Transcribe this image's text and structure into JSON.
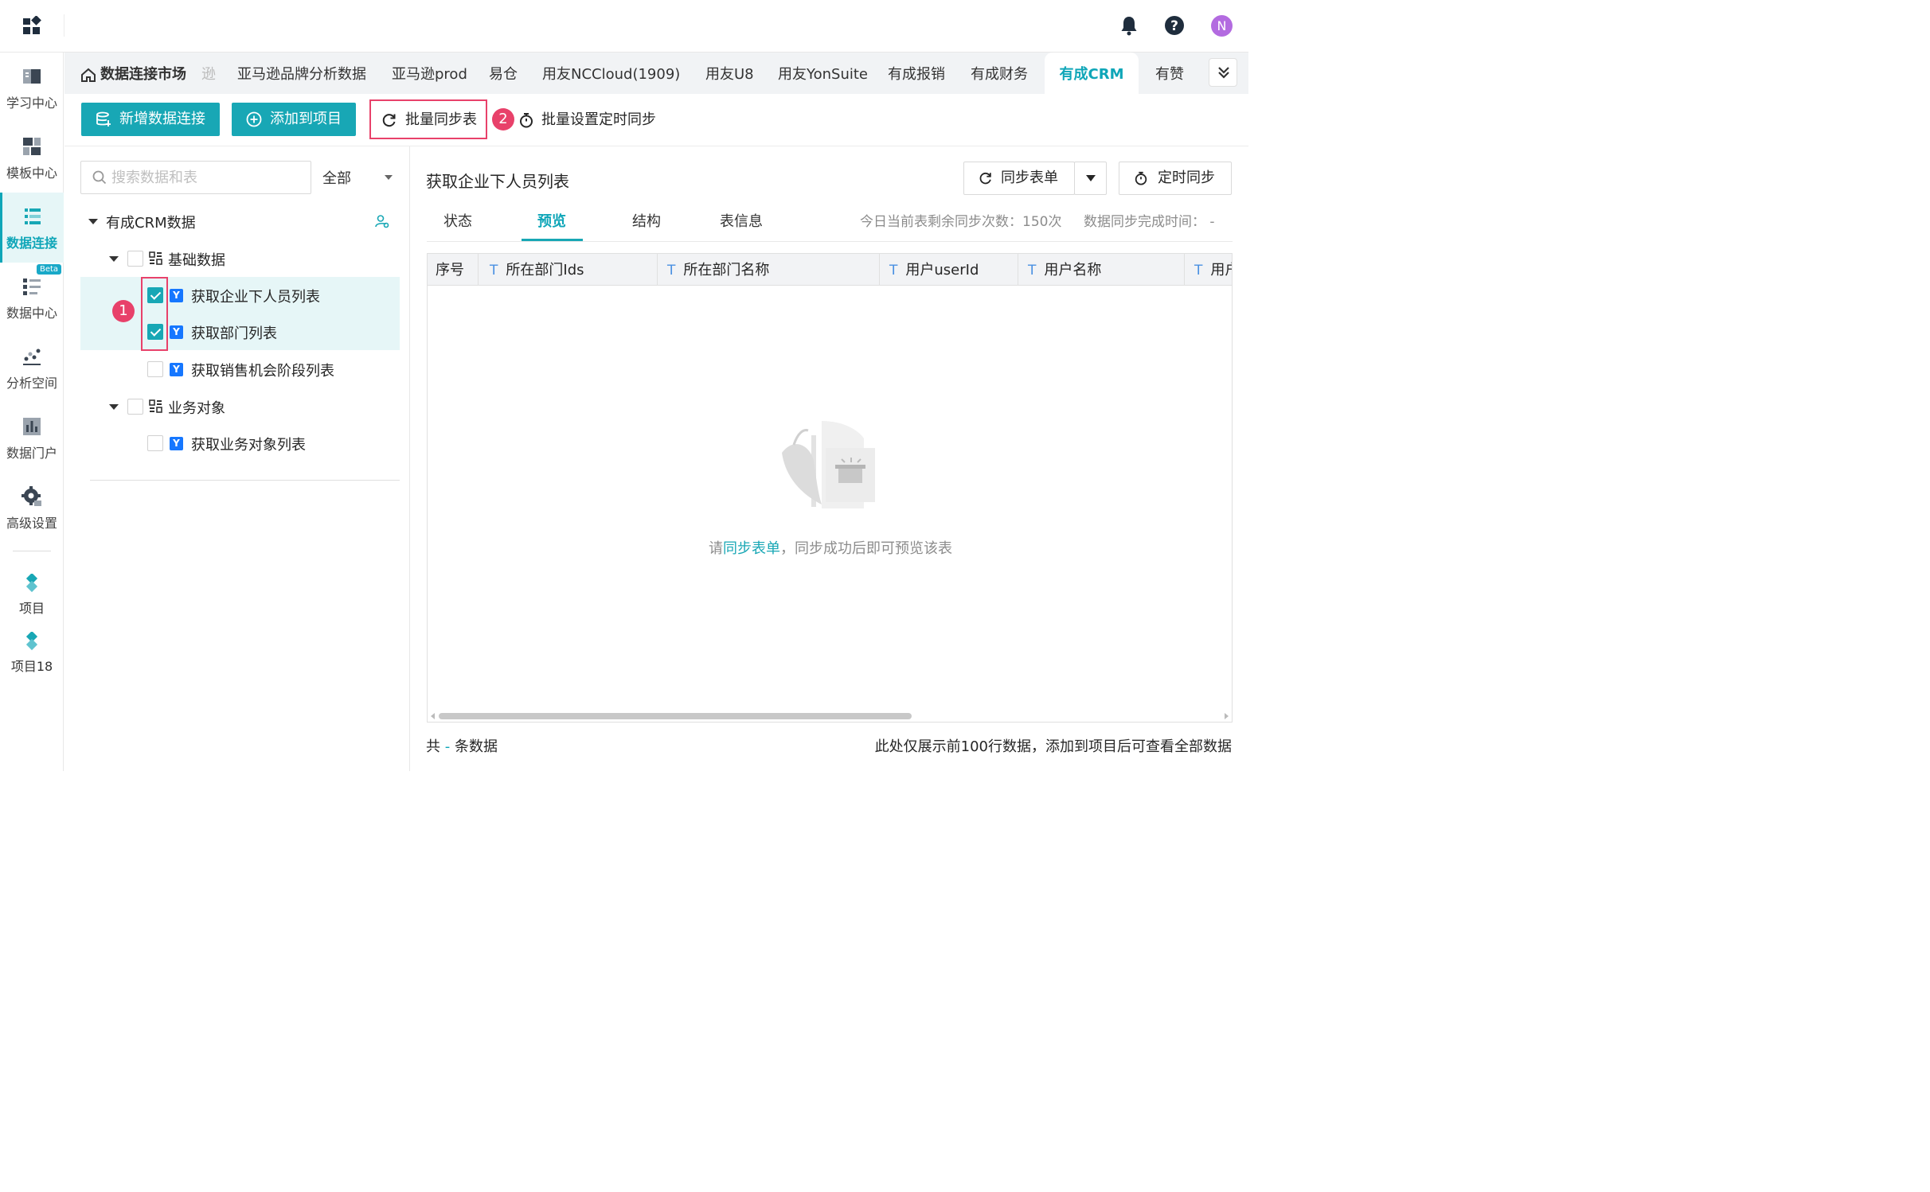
{
  "topbar": {
    "avatar_letter": "N"
  },
  "sidebar": {
    "items": [
      {
        "label": "学习中心"
      },
      {
        "label": "模板中心"
      },
      {
        "label": "数据连接"
      },
      {
        "label": "数据中心"
      },
      {
        "label": "分析空间"
      },
      {
        "label": "数据门户"
      },
      {
        "label": "高级设置"
      }
    ],
    "beta": "Beta",
    "projects": [
      {
        "label": "项目"
      },
      {
        "label": "项目18"
      }
    ]
  },
  "tabs": {
    "home": "数据连接市场",
    "dim": "逊",
    "items": [
      "亚马逊品牌分析数据",
      "亚马逊prod",
      "易仓",
      "用友NCCloud(1909)",
      "用友U8",
      "用友YonSuite",
      "有成报销",
      "有成财务",
      "有成CRM",
      "有赞"
    ],
    "active": "有成CRM"
  },
  "toolbar": {
    "new_connection": "新增数据连接",
    "add_to_project": "添加到项目",
    "batch_sync": "批量同步表",
    "batch_schedule": "批量设置定时同步",
    "badge_1": "1",
    "badge_2": "2"
  },
  "left": {
    "search_placeholder": "搜索数据和表",
    "filter": "全部",
    "root": "有成CRM数据",
    "groups": [
      {
        "name": "基础数据",
        "tables": [
          {
            "name": "获取企业下人员列表",
            "checked": true
          },
          {
            "name": "获取部门列表",
            "checked": true
          },
          {
            "name": "获取销售机会阶段列表",
            "checked": false
          }
        ]
      },
      {
        "name": "业务对象",
        "tables": [
          {
            "name": "获取业务对象列表",
            "checked": false
          }
        ]
      }
    ],
    "badge_letter": "Y"
  },
  "right": {
    "title": "获取企业下人员列表",
    "sync_button": "同步表单",
    "schedule_button": "定时同步",
    "subtabs": [
      "状态",
      "预览",
      "结构",
      "表信息"
    ],
    "active_subtab": "预览",
    "remaining_sync": "今日当前表剩余同步次数：150次",
    "sync_done_time": "数据同步完成时间： -",
    "columns": [
      {
        "type": "",
        "name": "序号"
      },
      {
        "type": "T",
        "name": "所在部门Ids"
      },
      {
        "type": "T",
        "name": "所在部门名称"
      },
      {
        "type": "T",
        "name": "用户userId"
      },
      {
        "type": "T",
        "name": "用户名称"
      },
      {
        "type": "T",
        "name": "用户"
      }
    ],
    "empty": {
      "prefix": "请",
      "link": "同步表单",
      "suffix": "，同步成功后即可预览该表"
    },
    "footer": {
      "total_prefix": "共",
      "total_value": "-",
      "total_suffix": "条数据",
      "note": "此处仅展示前100行数据，添加到项目后可查看全部数据"
    }
  },
  "colors": {
    "accent": "#18a7b5",
    "highlight": "#e8416a"
  }
}
